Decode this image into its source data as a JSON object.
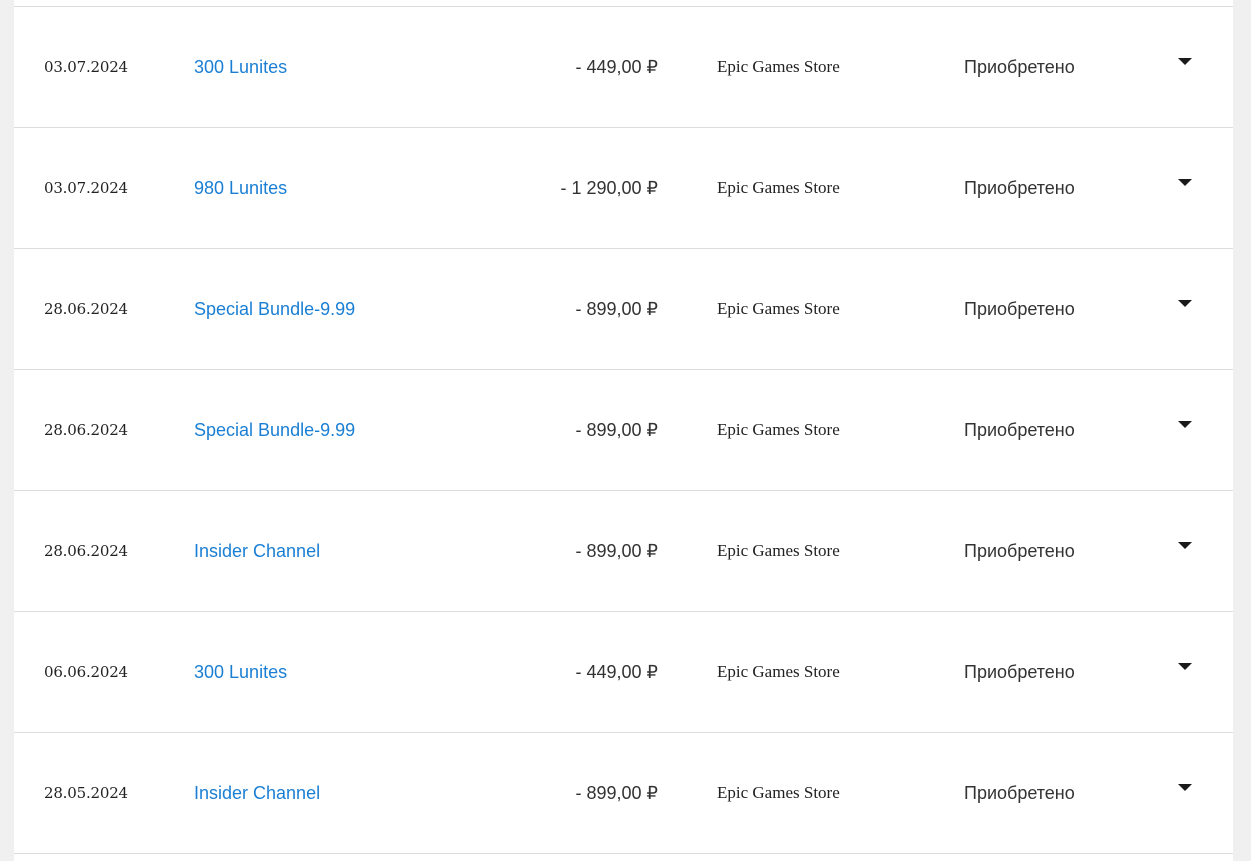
{
  "transactions": [
    {
      "date": "03.07.2024",
      "item": "300 Lunites",
      "amount": "- 449,00 ₽",
      "store": "Epic Games Store",
      "status": "Приобретено",
      "toggle_icon": "caret-down-icon"
    },
    {
      "date": "03.07.2024",
      "item": "980 Lunites",
      "amount": "- 1 290,00 ₽",
      "store": "Epic Games Store",
      "status": "Приобретено",
      "toggle_icon": "caret-down-icon"
    },
    {
      "date": "28.06.2024",
      "item": "Special Bundle-9.99",
      "amount": "- 899,00 ₽",
      "store": "Epic Games Store",
      "status": "Приобретено",
      "toggle_icon": "caret-down-icon"
    },
    {
      "date": "28.06.2024",
      "item": "Special Bundle-9.99",
      "amount": "- 899,00 ₽",
      "store": "Epic Games Store",
      "status": "Приобретено",
      "toggle_icon": "caret-down-icon"
    },
    {
      "date": "28.06.2024",
      "item": "Insider Channel",
      "amount": "- 899,00 ₽",
      "store": "Epic Games Store",
      "status": "Приобретено",
      "toggle_icon": "caret-down-icon"
    },
    {
      "date": "06.06.2024",
      "item": "300 Lunites",
      "amount": "- 449,00 ₽",
      "store": "Epic Games Store",
      "status": "Приобретено",
      "toggle_icon": "caret-down-icon"
    },
    {
      "date": "28.05.2024",
      "item": "Insider Channel",
      "amount": "- 899,00 ₽",
      "store": "Epic Games Store",
      "status": "Приобретено",
      "toggle_icon": "caret-down-icon"
    }
  ],
  "colors": {
    "link": "#1a7fd4",
    "text": "#333333",
    "divider": "#dddddd",
    "background": "#f0f0f0",
    "panel": "#ffffff"
  }
}
